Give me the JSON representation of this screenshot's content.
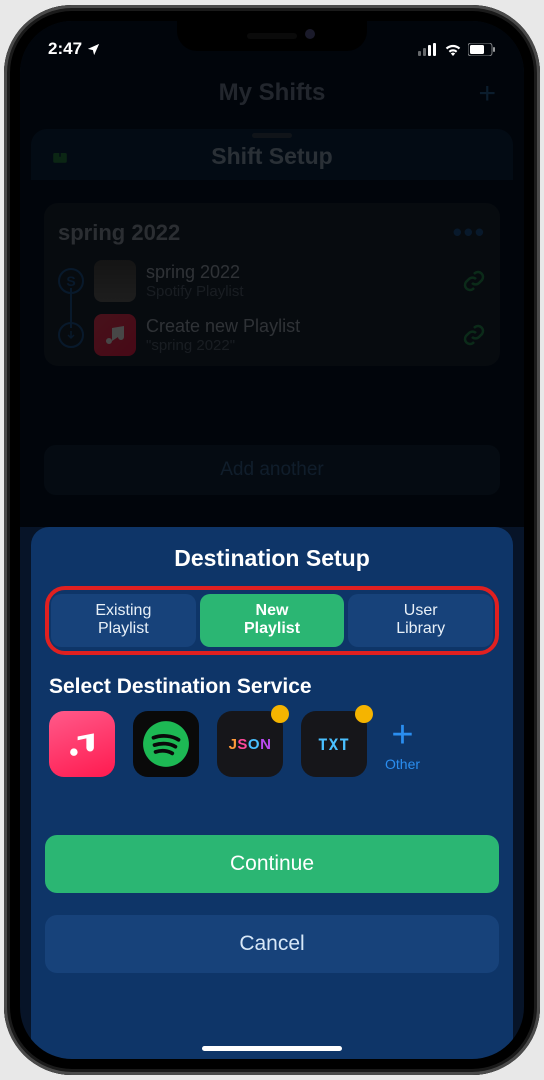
{
  "status": {
    "time": "2:47"
  },
  "background": {
    "top_title": "My Shifts",
    "modal_title": "Shift Setup",
    "card": {
      "title": "spring 2022",
      "source": {
        "name": "spring 2022",
        "subtitle": "Spotify Playlist"
      },
      "dest": {
        "name": "Create new Playlist",
        "subtitle": "\"spring 2022\""
      }
    },
    "add_another": "Add another"
  },
  "sheet": {
    "title": "Destination Setup",
    "seg": {
      "existing": {
        "l1": "Existing",
        "l2": "Playlist"
      },
      "new_": {
        "l1": "New",
        "l2": "Playlist"
      },
      "user": {
        "l1": "User",
        "l2": "Library"
      }
    },
    "select_title": "Select Destination Service",
    "other_label": "Other",
    "continue": "Continue",
    "cancel": "Cancel"
  }
}
